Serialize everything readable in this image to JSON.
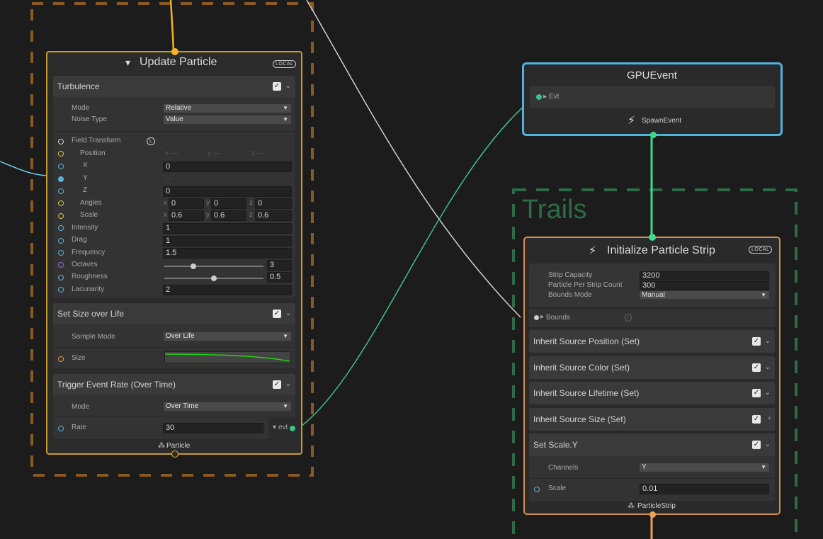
{
  "update": {
    "title": "Update Particle",
    "badge": "LOCAL",
    "footer": "Particle",
    "turbulence": {
      "title": "Turbulence",
      "mode_label": "Mode",
      "mode_value": "Relative",
      "noise_label": "Noise Type",
      "noise_value": "Value",
      "field_transform": "Field Transform",
      "field_transform_badge": "L",
      "position": "Position",
      "x_label": "X",
      "x_value": "0",
      "y_label": "Y",
      "y_value": "—",
      "z_label": "Z",
      "z_value": "0",
      "pos_dims": [
        "x",
        "y",
        "z"
      ],
      "pos_vals": [
        "—",
        "—",
        "—"
      ],
      "angles": "Angles",
      "angles_vals": [
        "0",
        "0",
        "0"
      ],
      "scale": "Scale",
      "scale_vals": [
        "0.6",
        "0.6",
        "0.6"
      ],
      "intensity_label": "Intensity",
      "intensity_value": "1",
      "drag_label": "Drag",
      "drag_value": "1",
      "frequency_label": "Frequency",
      "frequency_value": "1.5",
      "octaves_label": "Octaves",
      "octaves_value": "3",
      "octaves_fraction": 0.29,
      "roughness_label": "Roughness",
      "roughness_value": "0.5",
      "roughness_fraction": 0.5,
      "lacunarity_label": "Lacunarity",
      "lacunarity_value": "2"
    },
    "size_over_life": {
      "title": "Set Size over Life",
      "sample_label": "Sample Mode",
      "sample_value": "Over Life",
      "size_label": "Size"
    },
    "trigger": {
      "title": "Trigger Event Rate (Over Time)",
      "mode_label": "Mode",
      "mode_value": "Over Time",
      "rate_label": "Rate",
      "rate_value": "30",
      "evt_label": "evt"
    }
  },
  "gpuevent": {
    "title": "GPUEvent",
    "evt_label": "Evt",
    "footer": "SpawnEvent"
  },
  "trails": {
    "title": "Trails"
  },
  "strip": {
    "title": "Initialize Particle Strip",
    "badge": "LOCAL",
    "capacity_label": "Strip Capacity",
    "capacity_value": "3200",
    "per_strip_label": "Particle Per Strip Count",
    "per_strip_value": "300",
    "bounds_mode_label": "Bounds Mode",
    "bounds_mode_value": "Manual",
    "bounds_label": "Bounds",
    "blocks": [
      {
        "title": "Inherit Source Position (Set)"
      },
      {
        "title": "Inherit Source Color (Set)"
      },
      {
        "title": "Inherit Source Lifetime (Set)"
      },
      {
        "title": "Inherit Source Size (Set)"
      },
      {
        "title": "Set Scale.Y"
      }
    ],
    "channels_label": "Channels",
    "channels_value": "Y",
    "scale_label": "Scale",
    "scale_value": "0.01",
    "footer": "ParticleStrip"
  },
  "colors": {
    "flow_yellow": "#f2b322",
    "event_green": "#3ddc8f",
    "gpuevent_border": "#4fb3e0",
    "trails_green": "#2e6b47",
    "strip_border": "#d4904f",
    "update_border": "#c99a2e",
    "curve": "#22d40f"
  }
}
